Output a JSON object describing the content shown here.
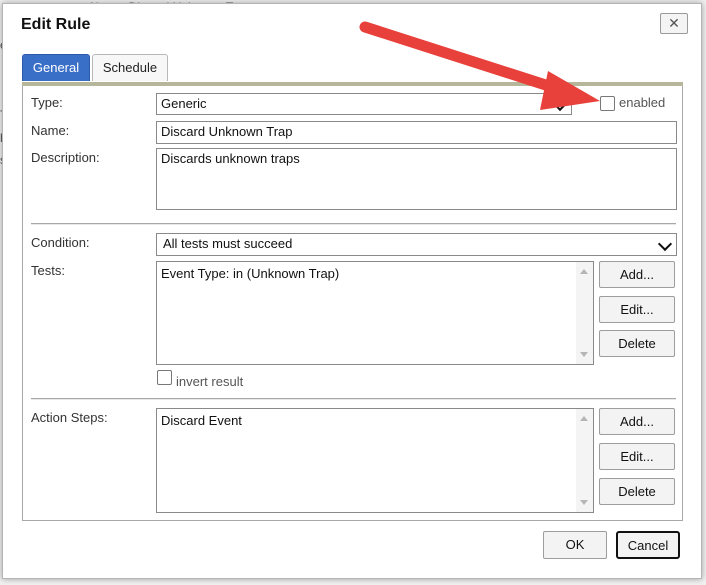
{
  "background": {
    "header_text": "Name:        Discard Unknown Trap",
    "fragments": [
      "ec",
      "Tr",
      "he",
      "s"
    ]
  },
  "dialog": {
    "title": "Edit Rule",
    "close_symbol": "✕"
  },
  "tabs": [
    {
      "label": "General",
      "active": true
    },
    {
      "label": "Schedule",
      "active": false
    }
  ],
  "general": {
    "type_label": "Type:",
    "type_value": "Generic",
    "enabled_label": "enabled",
    "enabled_checked": false,
    "name_label": "Name:",
    "name_value": "Discard Unknown Trap",
    "description_label": "Description:",
    "description_value": "Discards unknown traps",
    "condition_label": "Condition:",
    "condition_value": "All tests must succeed",
    "tests_label": "Tests:",
    "tests_items": [
      "Event Type: in (Unknown Trap)"
    ],
    "tests_buttons": {
      "add": "Add...",
      "edit": "Edit...",
      "delete": "Delete"
    },
    "invert_label": "invert result",
    "invert_checked": false,
    "action_steps_label": "Action Steps:",
    "action_items": [
      "Discard Event"
    ],
    "action_buttons": {
      "add": "Add...",
      "edit": "Edit...",
      "delete": "Delete"
    }
  },
  "footer": {
    "ok_label": "OK",
    "cancel_label": "Cancel"
  },
  "colors": {
    "active_tab": "#3a6fc8",
    "annotation_arrow": "#e8403a"
  },
  "icons": {
    "close": "close-icon",
    "select": "chevron-down-icon",
    "scroll_up": "scroll-up-icon",
    "scroll_down": "scroll-down-icon"
  }
}
